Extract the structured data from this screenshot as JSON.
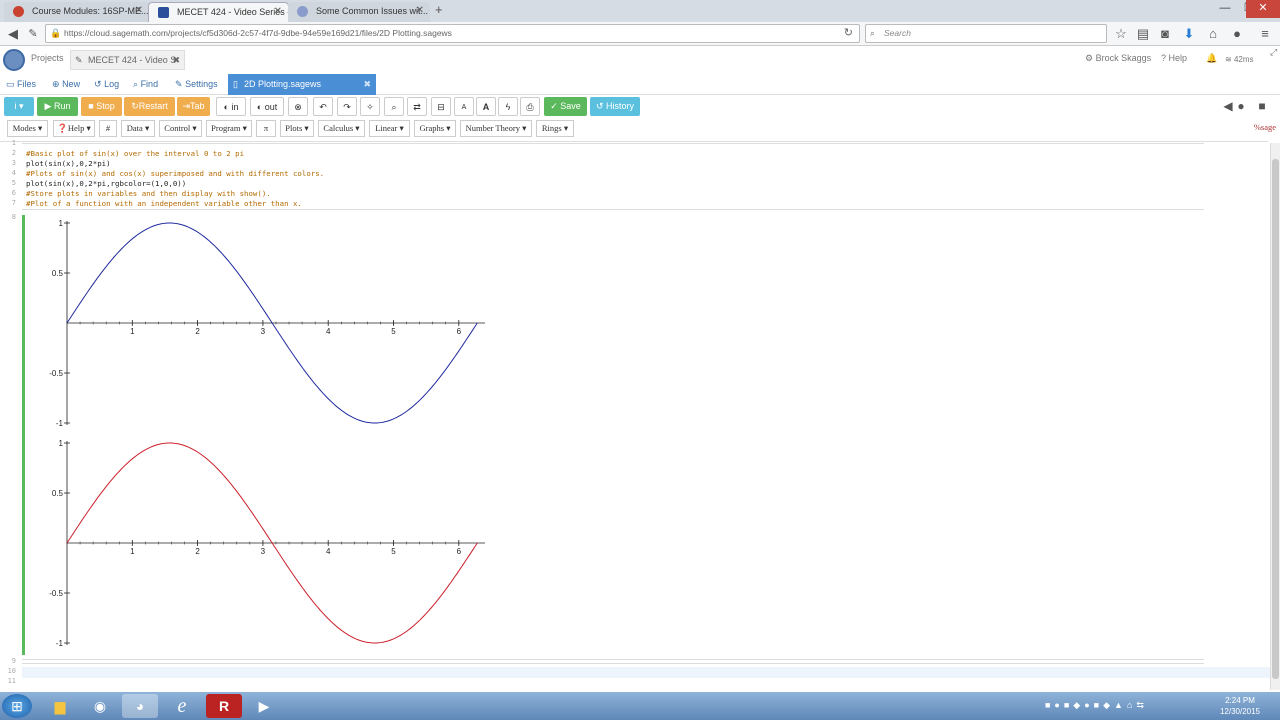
{
  "browser": {
    "tabs": [
      {
        "title": "Course Modules: 16SP-ME...",
        "active": false
      },
      {
        "title": "MECET 424 - Video Series -...",
        "active": true
      },
      {
        "title": "Some Common Issues wit...",
        "active": false
      }
    ],
    "new_tab": "+",
    "url": "https://cloud.sagemath.com/projects/cf5d306d-2c57-4f7d-9dbe-94e59e169d21/files/2D Plotting.sagews",
    "search_placeholder": "Search"
  },
  "sage_top": {
    "projects": "Projects",
    "project_tab": "MECET 424 - Video S",
    "user": "Brock Skaggs",
    "help": "Help",
    "latency": "42ms"
  },
  "file_bar": {
    "files": "Files",
    "new": "New",
    "log": "Log",
    "find": "Find",
    "settings": "Settings",
    "open_file": "2D Plotting.sagews"
  },
  "toolbar": {
    "info": "i",
    "run": "Run",
    "stop": "Stop",
    "restart": "Restart",
    "tab": "Tab",
    "in": "in",
    "out": "out",
    "save": "Save",
    "history": "History"
  },
  "menus": [
    "Modes",
    "Help",
    "Data",
    "Control",
    "Program",
    "π",
    "Plots",
    "Calculus",
    "Linear",
    "Graphs",
    "Number Theory",
    "Rings"
  ],
  "menu_hash": "#",
  "mode_label": "%sage",
  "code_lines": [
    {
      "n": "1",
      "text": "",
      "kind": "code"
    },
    {
      "n": "2",
      "text": "#Basic plot of sin(x) over the interval 0 to 2 pi",
      "kind": "comment"
    },
    {
      "n": "3",
      "text": "plot(sin(x),0,2*pi)",
      "kind": "code"
    },
    {
      "n": "4",
      "text": "#Plots of sin(x) and cos(x) superimposed and with different colors.",
      "kind": "comment"
    },
    {
      "n": "5",
      "text": "plot(sin(x),0,2*pi,rgbcolor=(1,0,0))",
      "kind": "code"
    },
    {
      "n": "6",
      "text": "#Store plots in variables and then display with show().",
      "kind": "comment"
    },
    {
      "n": "7",
      "text": "#Plot of a function with an independent variable other than x.",
      "kind": "comment"
    }
  ],
  "lower_line_numbers": [
    "9",
    "10",
    "11"
  ],
  "output_line_number": "8",
  "chart_data": [
    {
      "type": "line",
      "function": "sin(x)",
      "xlim": [
        0,
        6.283
      ],
      "ylim": [
        -1,
        1
      ],
      "xticks": [
        "1",
        "2",
        "3",
        "4",
        "5",
        "6"
      ],
      "yticks": [
        "1",
        "0.5",
        "-0.5",
        "-1"
      ],
      "series": [
        {
          "color": "#1f2aa0"
        }
      ]
    },
    {
      "type": "line",
      "function": "sin(x)",
      "xlim": [
        0,
        6.283
      ],
      "ylim": [
        -1,
        1
      ],
      "xticks": [
        "1",
        "2",
        "3",
        "4",
        "5",
        "6"
      ],
      "yticks": [
        "1",
        "0.5",
        "-0.5",
        "-1"
      ],
      "series": [
        {
          "color": "#cc1f2a"
        }
      ]
    }
  ],
  "taskbar": {
    "time": "2:24 PM",
    "date": "12/30/2015"
  }
}
